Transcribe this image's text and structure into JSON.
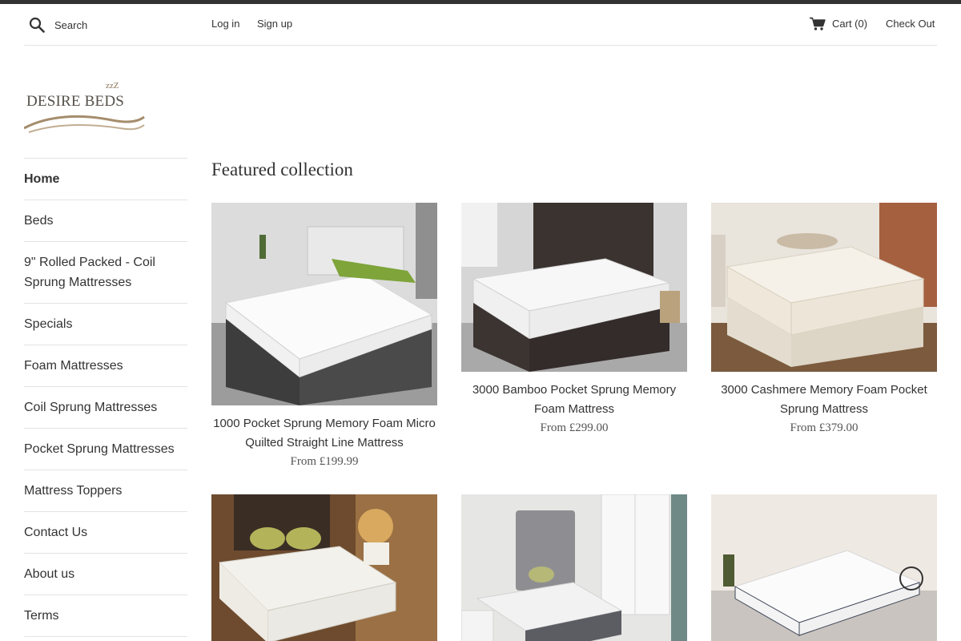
{
  "header": {
    "search_placeholder": "Search",
    "login": "Log in",
    "signup": "Sign up",
    "cart": "Cart (0)",
    "checkout": "Check Out"
  },
  "brand": {
    "name": "DESIRE BEDS",
    "zzz": "zzZ"
  },
  "sidebar": {
    "items": [
      {
        "label": "Home",
        "active": true
      },
      {
        "label": "Beds"
      },
      {
        "label": "9\" Rolled Packed - Coil Sprung Mattresses"
      },
      {
        "label": "Specials"
      },
      {
        "label": "Foam Mattresses"
      },
      {
        "label": "Coil Sprung Mattresses"
      },
      {
        "label": "Pocket Sprung Mattresses"
      },
      {
        "label": "Mattress Toppers"
      },
      {
        "label": "Contact Us"
      },
      {
        "label": "About us"
      },
      {
        "label": "Terms"
      }
    ]
  },
  "main": {
    "section_title": "Featured collection",
    "products": [
      {
        "title": "1000 Pocket Sprung Memory Foam Micro Quilted Straight Line Mattress",
        "price": "From £199.99"
      },
      {
        "title": "3000 Bamboo Pocket Sprung Memory Foam Mattress",
        "price": "From £299.00"
      },
      {
        "title": "3000 Cashmere Memory Foam Pocket Sprung Mattress",
        "price": "From £379.00"
      },
      {
        "title": "",
        "price": ""
      },
      {
        "title": "",
        "price": ""
      },
      {
        "title": "",
        "price": ""
      }
    ]
  },
  "colors": {
    "text": "#333333",
    "border": "#e3e3e3",
    "top_strip": "#333333"
  }
}
